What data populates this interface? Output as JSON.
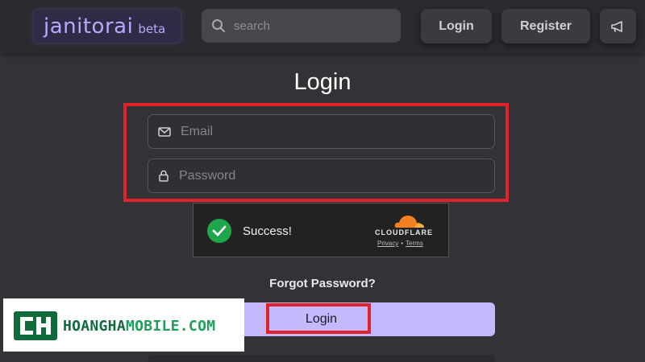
{
  "header": {
    "logo_text": "janitorai",
    "logo_badge": "beta",
    "search_placeholder": "search",
    "login_label": "Login",
    "register_label": "Register",
    "announce_icon": "megaphone-icon"
  },
  "main": {
    "title": "Login",
    "email_placeholder": "Email",
    "password_placeholder": "Password",
    "email_icon": "mail-icon",
    "password_icon": "lock-icon"
  },
  "captcha": {
    "status": "Success!",
    "provider": "CLOUDFLARE",
    "privacy_label": "Privacy",
    "separator": "•",
    "terms_label": "Terms"
  },
  "forgot_password_label": "Forgot Password?",
  "login_button_label": "Login",
  "watermark": {
    "text_part1": "HOANGHA",
    "text_part2": "MOBILE.COM"
  },
  "colors": {
    "background": "#323237",
    "accent": "#c6b8ff",
    "highlight": "#e0222a",
    "success": "#1ea64a",
    "cloudflare_orange": "#f38020"
  }
}
